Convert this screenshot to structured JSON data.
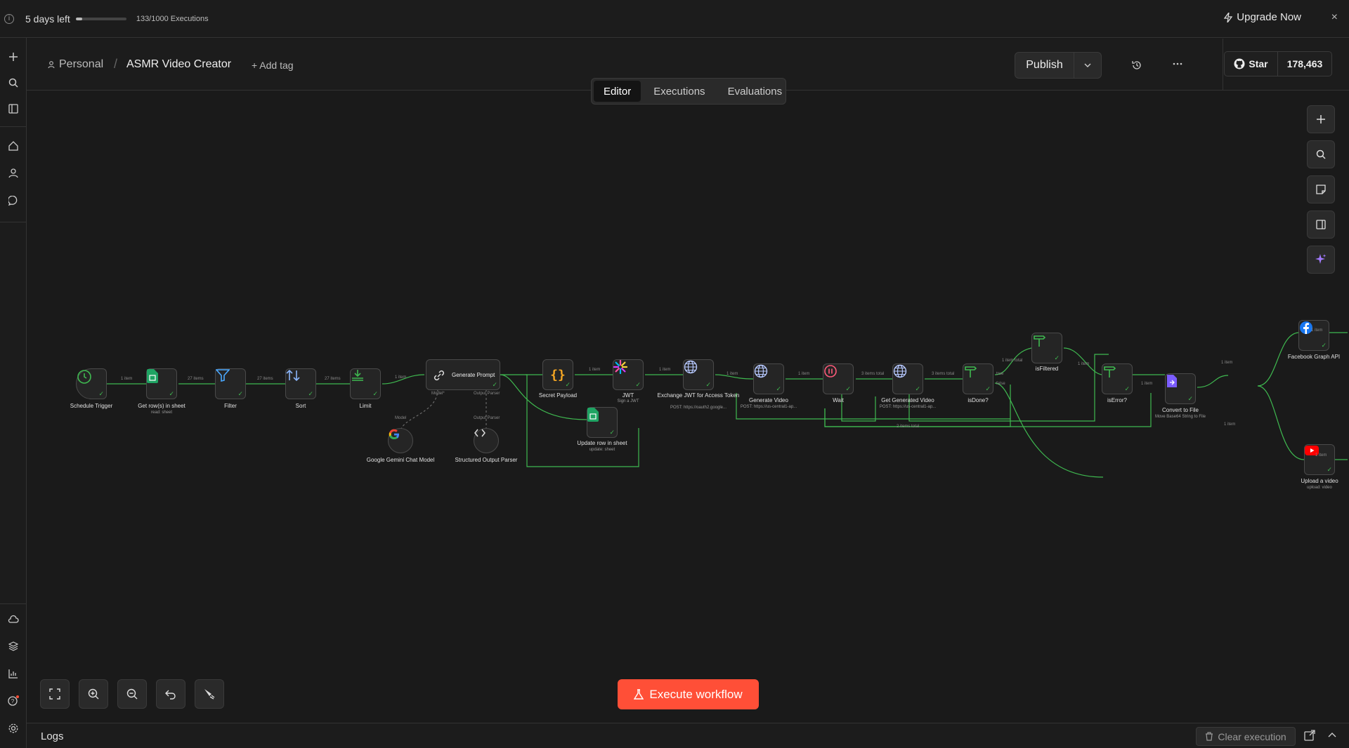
{
  "topbar": {
    "trial_text": "5 days left",
    "trial_progress": 0.133,
    "executions_text": "133/1000 Executions",
    "upgrade_label": "Upgrade Now",
    "close_label": "×"
  },
  "header": {
    "project": "Personal",
    "workflow_title": "ASMR Video Creator",
    "add_tag_label": "+ Add tag",
    "publish_label": "Publish",
    "github_star_label": "Star",
    "github_star_count": "178,463"
  },
  "tabs": [
    {
      "label": "Editor",
      "active": true
    },
    {
      "label": "Executions",
      "active": false
    },
    {
      "label": "Evaluations",
      "active": false
    }
  ],
  "nodes": {
    "schedule_trigger": {
      "label": "Schedule Trigger"
    },
    "get_rows": {
      "label": "Get row(s) in sheet",
      "sub": "read: sheet"
    },
    "filter": {
      "label": "Filter"
    },
    "sort": {
      "label": "Sort"
    },
    "limit": {
      "label": "Limit"
    },
    "generate_prompt": {
      "label": "Generate Prompt"
    },
    "gemini": {
      "label": "Google Gemini Chat Model"
    },
    "output_parser": {
      "label": "Structured Output Parser"
    },
    "secret_payload": {
      "label": "Secret Payload"
    },
    "update_row": {
      "label": "Update row in sheet",
      "sub": "update: sheet"
    },
    "jwt": {
      "label": "JWT",
      "sub": "Sign a JWT"
    },
    "exchange_jwt": {
      "label": "Exchange JWT for Access Token",
      "sub": "POST: https://oauth2.google..."
    },
    "generate_video": {
      "label": "Generate Video",
      "sub": "POST: https://us-central1-ap..."
    },
    "wait": {
      "label": "Wait"
    },
    "get_generated_video": {
      "label": "Get Generated Video",
      "sub": "POST: https://us-central1-ap..."
    },
    "is_done": {
      "label": "isDone?"
    },
    "is_filtered": {
      "label": "isFiltered"
    },
    "is_error": {
      "label": "isError?"
    },
    "convert_to_file": {
      "label": "Convert to File",
      "sub": "Move Base64 String to File"
    },
    "facebook": {
      "label": "Facebook Graph API"
    },
    "upload_video": {
      "label": "Upload a video",
      "sub": "upload: video"
    }
  },
  "edge_labels": {
    "e1": "1 item",
    "e2": "27 items",
    "e3": "27 items",
    "e4": "27 items",
    "e5": "1 item",
    "e6": "1 item",
    "e7": "1 item",
    "e8": "1 item",
    "e9": "1 item",
    "e10": "3 items total",
    "e11": "3 items total",
    "e12": "1 item total",
    "e13": "1 item",
    "e14": "1 item",
    "e15": "1 item",
    "e16": "1 item",
    "e17": "1 item",
    "e18": "2 items total",
    "e19": "1 item",
    "model_lbl": "Model*",
    "parser_lbl": "Output Parser",
    "model_lbl2": "Model",
    "parser_lbl2": "Output Parser",
    "true_lbl": "true",
    "false_lbl": "false"
  },
  "execute_label": "Execute workflow",
  "footer": {
    "logs_label": "Logs",
    "clear_label": "Clear execution"
  },
  "colors": {
    "accent": "#ff4f37",
    "edge_success": "#3fb950",
    "background": "#1a1a1a"
  }
}
